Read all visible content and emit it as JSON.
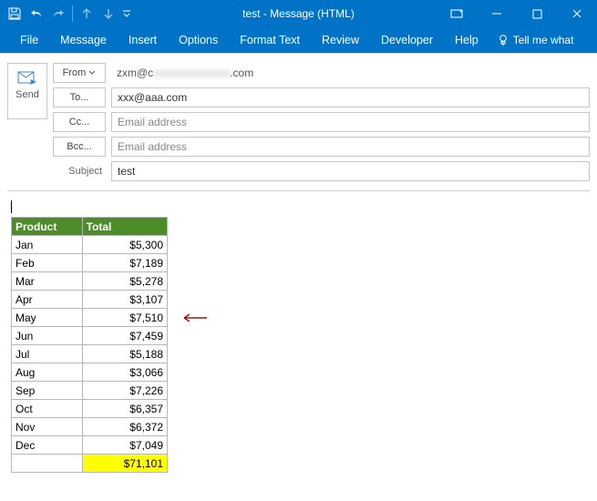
{
  "window": {
    "title": "test  -  Message (HTML)"
  },
  "qat": {
    "save": "save",
    "undo": "undo",
    "redo": "redo",
    "prev": "prev",
    "next": "next",
    "customize": "customize"
  },
  "tabs": [
    "File",
    "Message",
    "Insert",
    "Options",
    "Format Text",
    "Review",
    "Developer",
    "Help"
  ],
  "tell_me": "Tell me what",
  "send": {
    "label": "Send"
  },
  "fields": {
    "from_label": "From",
    "from_value_prefix": "zxm@c",
    "from_value_suffix": ".com",
    "to_label": "To...",
    "to_value": "xxx@aaa.com",
    "cc_label": "Cc...",
    "cc_placeholder": "Email address",
    "bcc_label": "Bcc...",
    "bcc_placeholder": "Email address",
    "subject_label": "Subject",
    "subject_value": "test"
  },
  "table": {
    "headers": [
      "Product",
      "Total"
    ],
    "rows": [
      {
        "prod": "Jan",
        "val": "$5,300"
      },
      {
        "prod": "Feb",
        "val": "$7,189"
      },
      {
        "prod": "Mar",
        "val": "$5,278"
      },
      {
        "prod": "Apr",
        "val": "$3,107"
      },
      {
        "prod": "May",
        "val": "$7,510"
      },
      {
        "prod": "Jun",
        "val": "$7,459"
      },
      {
        "prod": "Jul",
        "val": "$5,188"
      },
      {
        "prod": "Aug",
        "val": "$3,066"
      },
      {
        "prod": "Sep",
        "val": "$7,226"
      },
      {
        "prod": "Oct",
        "val": "$6,357"
      },
      {
        "prod": "Nov",
        "val": "$6,372"
      },
      {
        "prod": "Dec",
        "val": "$7,049"
      }
    ],
    "total_value": "$71,101",
    "arrow_row_index": 4
  }
}
